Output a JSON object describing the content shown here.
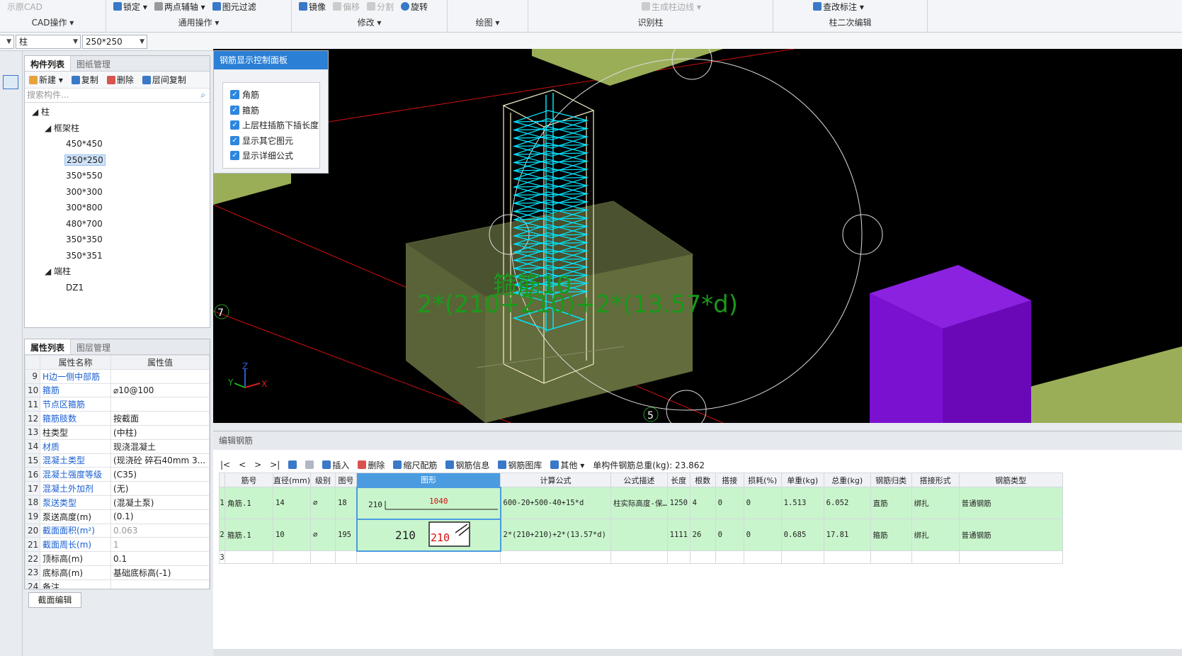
{
  "ribbon": {
    "cad_group": {
      "item": "示原CAD",
      "label": "CAD操作 ▾"
    },
    "general_group": {
      "items": [
        "锁定 ▾",
        "两点辅轴 ▾",
        "图元过滤"
      ],
      "label": "通用操作 ▾"
    },
    "modify_group": {
      "items": [
        "镜像",
        "偏移",
        "分割",
        "旋转"
      ],
      "label": "修改 ▾"
    },
    "draw_group": {
      "label": "绘图 ▾"
    },
    "identify_group": {
      "items": [
        "生成柱边线 ▾"
      ],
      "label": "识别柱"
    },
    "edit2_group": {
      "items": [
        "查改标注 ▾"
      ],
      "label": "柱二次编辑"
    }
  },
  "toolbar2": {
    "type_value": "柱",
    "size_value": "250*250"
  },
  "component_panel": {
    "tabs": [
      "构件列表",
      "图纸管理"
    ],
    "tools": [
      "新建 ▾",
      "复制",
      "删除",
      "层间复制"
    ],
    "search_placeholder": "搜索构件...",
    "tree": {
      "root": "柱",
      "group1": "框架柱",
      "group1_items": [
        "450*450",
        "250*250",
        "350*550",
        "300*300",
        "300*800",
        "480*700",
        "350*350",
        "350*351"
      ],
      "group2": "端柱",
      "group2_items": [
        "DZ1"
      ]
    }
  },
  "property_panel": {
    "tabs": [
      "属性列表",
      "图层管理"
    ],
    "headers": [
      "属性名称",
      "属性值"
    ],
    "rows": [
      {
        "n": "9",
        "name": "H边一侧中部筋",
        "value": "",
        "blue": true
      },
      {
        "n": "10",
        "name": "箍筋",
        "value": "⌀10@100",
        "blue": true
      },
      {
        "n": "11",
        "name": "节点区箍筋",
        "value": "",
        "blue": true
      },
      {
        "n": "12",
        "name": "箍筋肢数",
        "value": "按截面",
        "blue": true
      },
      {
        "n": "13",
        "name": "柱类型",
        "value": "(中柱)",
        "blue": false
      },
      {
        "n": "14",
        "name": "材质",
        "value": "现浇混凝土",
        "blue": true
      },
      {
        "n": "15",
        "name": "混凝土类型",
        "value": "(现浇砼 碎石40mm 3...",
        "blue": true
      },
      {
        "n": "16",
        "name": "混凝土强度等级",
        "value": "(C35)",
        "blue": true
      },
      {
        "n": "17",
        "name": "混凝土外加剂",
        "value": "(无)",
        "blue": true
      },
      {
        "n": "18",
        "name": "泵送类型",
        "value": "(混凝土泵)",
        "blue": true
      },
      {
        "n": "19",
        "name": "泵送高度(m)",
        "value": "(0.1)",
        "blue": false
      },
      {
        "n": "20",
        "name": "截面面积(m²)",
        "value": "0.063",
        "blue": true,
        "grey": true
      },
      {
        "n": "21",
        "name": "截面周长(m)",
        "value": "1",
        "blue": true,
        "grey": true
      },
      {
        "n": "22",
        "name": "顶标高(m)",
        "value": "0.1",
        "blue": false
      },
      {
        "n": "23",
        "name": "底标高(m)",
        "value": "基础底标高(-1)",
        "blue": false
      },
      {
        "n": "24",
        "name": "备注",
        "value": "",
        "blue": false
      }
    ],
    "section_edit_button": "截面编辑"
  },
  "control_panel": {
    "title": "钢筋显示控制面板",
    "options": [
      "角筋",
      "箍筋",
      "上层柱插筋下插长度",
      "显示其它图元",
      "显示详细公式"
    ]
  },
  "viewport": {
    "axis_labels": [
      "7",
      "5"
    ],
    "overlay_text1": "箍筋10",
    "overlay_text2": "2*(210+210)+2*(13.57*d)",
    "axes": {
      "x": "X",
      "y": "Y",
      "z": "Z"
    }
  },
  "rebar_editor": {
    "title": "编辑钢筋",
    "nav": [
      "|<",
      "<",
      ">",
      ">|"
    ],
    "tools": [
      "插入",
      "删除",
      "缩尺配筋",
      "钢筋信息",
      "钢筋图库",
      "其他 ▾"
    ],
    "total_weight_label": "单构件钢筋总重(kg): 23.862",
    "headers": [
      "筋号",
      "直径(mm)",
      "级别",
      "图号",
      "图形",
      "计算公式",
      "公式描述",
      "长度",
      "根数",
      "搭接",
      "损耗(%)",
      "单重(kg)",
      "总重(kg)",
      "钢筋归类",
      "搭接形式",
      "钢筋类型"
    ],
    "rows": [
      {
        "idx": "1",
        "name": "角筋.1",
        "dia": "14",
        "grade": "⌀",
        "fig": "18",
        "shape_left": "210",
        "shape_val": "1040",
        "formula": "600-20+500-40+15*d",
        "desc": "柱实际高度-保…",
        "len": "1250",
        "count": "4",
        "lap": "0",
        "loss": "0",
        "unit_w": "1.513",
        "total_w": "6.052",
        "cat": "直筋",
        "lap_form": "绑扎",
        "type": "普通钢筋"
      },
      {
        "idx": "2",
        "name": "箍筋.1",
        "dia": "10",
        "grade": "⌀",
        "fig": "195",
        "shape_left": "210",
        "shape_val": "210",
        "formula": "2*(210+210)+2*(13.57*d)",
        "desc": "",
        "len": "1111",
        "count": "26",
        "lap": "0",
        "loss": "0",
        "unit_w": "0.685",
        "total_w": "17.81",
        "cat": "箍筋",
        "lap_form": "绑扎",
        "type": "普通钢筋"
      },
      {
        "idx": "3"
      }
    ]
  },
  "colors": {
    "accent": "#2b7fd4",
    "row_green": "#c9f5cc",
    "rebar": "#00e5ff",
    "column_slab": "#9aae58",
    "purple": "#7a10d0"
  }
}
